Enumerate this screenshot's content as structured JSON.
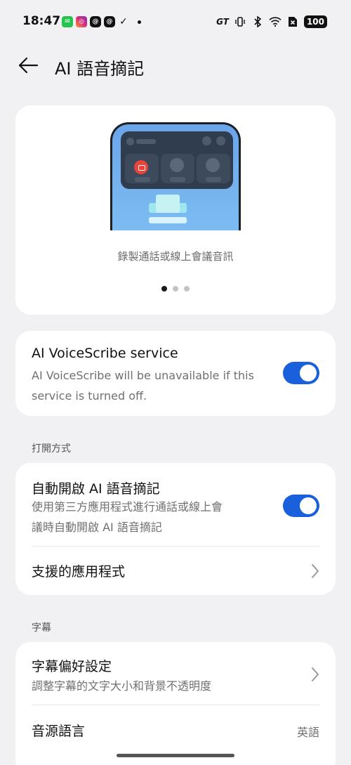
{
  "status_bar": {
    "time": "18:47",
    "app_icons": [
      "line-icon",
      "instagram-icon",
      "threads-icon",
      "threads-icon",
      "download-done-icon",
      "dot-icon"
    ],
    "gt_label": "GT",
    "battery": "100"
  },
  "header": {
    "title": "AI 語音摘記"
  },
  "hero": {
    "caption": "錄製通話或線上會議音訊",
    "pages": 3,
    "active_page": 1
  },
  "service": {
    "title": "AI VoiceScribe service",
    "subtitle_line1": "AI VoiceScribe will be unavailable if this",
    "subtitle_line2": "service is turned off.",
    "enabled": true
  },
  "open_method": {
    "section_title": "打開方式",
    "auto_open": {
      "title": "自動開啟 AI 語音摘記",
      "subtitle_line1": "使用第三方應用程式進行通話或線上會",
      "subtitle_line2": "議時自動開啟 AI 語音摘記",
      "enabled": true
    },
    "supported_apps": {
      "title": "支援的應用程式"
    }
  },
  "subtitles": {
    "section_title": "字幕",
    "preferences": {
      "title": "字幕偏好設定",
      "subtitle": "調整字幕的文字大小和背景不透明度"
    },
    "source_language": {
      "title": "音源語言",
      "value": "英語"
    }
  },
  "colors": {
    "accent": "#1a5fdc",
    "background": "#f1f1f3",
    "card": "#ffffff"
  }
}
